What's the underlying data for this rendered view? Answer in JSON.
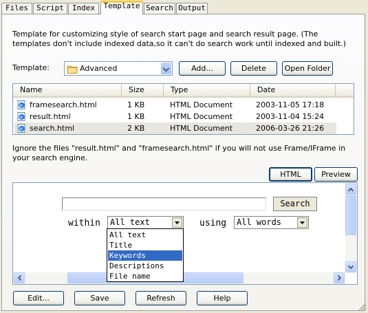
{
  "tabs": [
    {
      "label": "Files"
    },
    {
      "label": "Script"
    },
    {
      "label": "Index"
    },
    {
      "label": "Template"
    },
    {
      "label": "Search"
    },
    {
      "label": "Output"
    }
  ],
  "description": "Template for customizing style of search start page and search result page. (The templates don't include indexed data,so it can't do search work until indexed and built.)",
  "template_label": "Template:",
  "template_select": {
    "value": "Advanced"
  },
  "buttons": {
    "add": "Add...",
    "delete": "Delete",
    "open_folder": "Open Folder"
  },
  "file_list": {
    "columns": [
      "Name",
      "Size",
      "Type",
      "Date"
    ],
    "rows": [
      {
        "name": "framesearch.html",
        "size": "1 KB",
        "type": "HTML Document",
        "date": "2003-11-05 17:18"
      },
      {
        "name": "result.html",
        "size": "1 KB",
        "type": "HTML Document",
        "date": "2003-11-04 15:24"
      },
      {
        "name": "search.html",
        "size": "2 KB",
        "type": "HTML Document",
        "date": "2006-03-26 21:26"
      }
    ]
  },
  "note": "Ignore the files \"result.html\" and \"framesearch.html\" if you will not use Frame/IFrame in your search engine.",
  "view_buttons": {
    "html": "HTML",
    "preview": "Preview"
  },
  "preview": {
    "search_button": "Search",
    "within_label": "within",
    "within_value": "All text",
    "using_label": "using",
    "using_value": "All words",
    "dropdown_options": [
      "All text",
      "Title",
      "Keywords",
      "Descriptions",
      "File name"
    ],
    "highlighted_option": "Keywords"
  },
  "bottom_buttons": {
    "edit": "Edit...",
    "save": "Save",
    "refresh": "Refresh",
    "help": "Help"
  },
  "colors": {
    "accent_tab": "#ffc83c",
    "selection": "#316ac5",
    "button_border": "#003c74"
  }
}
